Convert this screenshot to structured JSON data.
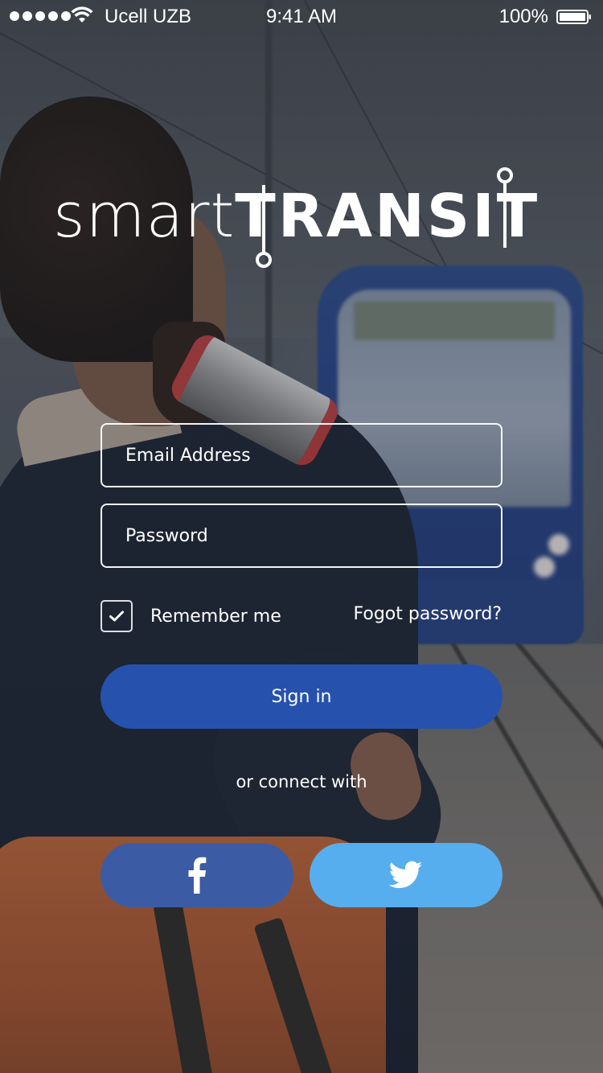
{
  "status_bar": {
    "carrier": "Ucell UZB",
    "time": "9:41 AM",
    "battery": "100%"
  },
  "logo": {
    "light_part": "smart",
    "bold_part": "TRANSIT"
  },
  "form": {
    "email_placeholder": "Email Address",
    "password_placeholder": "Password",
    "remember_label": "Remember me",
    "remember_checked": true,
    "forgot_label": "Fogot password?",
    "signin_label": "Sign in",
    "connect_label": "or connect with"
  },
  "social": {
    "facebook_icon": "facebook-icon",
    "twitter_icon": "twitter-icon"
  },
  "colors": {
    "signin": "#2652ae",
    "facebook": "#3b5ca4",
    "twitter": "#57aeee"
  }
}
